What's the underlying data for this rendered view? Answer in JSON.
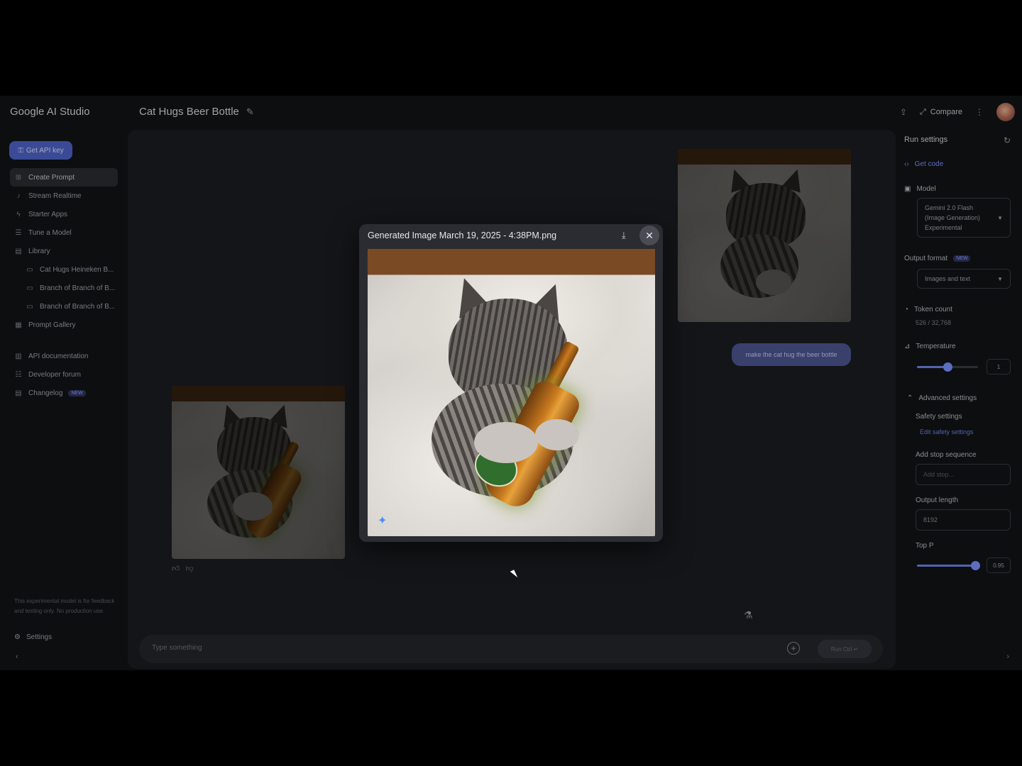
{
  "app": {
    "brand": "Google AI Studio",
    "prompt_title": "Cat Hugs Beer Bottle"
  },
  "topbar": {
    "compare_label": "Compare"
  },
  "sidebar": {
    "api_key_label": "Get API key",
    "items": [
      {
        "label": "Create Prompt",
        "icon": "create-prompt-icon"
      },
      {
        "label": "Stream Realtime",
        "icon": "mic-icon"
      },
      {
        "label": "Starter Apps",
        "icon": "bolt-icon"
      },
      {
        "label": "Tune a Model",
        "icon": "tune-icon"
      },
      {
        "label": "Library",
        "icon": "library-icon"
      },
      {
        "label": "Cat Hugs Heineken B...",
        "icon": "chat-icon"
      },
      {
        "label": "Branch of Branch of B...",
        "icon": "chat-icon"
      },
      {
        "label": "Branch of Branch of B...",
        "icon": "chat-icon"
      },
      {
        "label": "Prompt Gallery",
        "icon": "gallery-icon"
      },
      {
        "label": "API documentation",
        "icon": "docs-icon"
      },
      {
        "label": "Developer forum",
        "icon": "forum-icon"
      },
      {
        "label": "Changelog",
        "icon": "changelog-icon",
        "badge": "NEW"
      }
    ],
    "disclaimer": "This experimental model is for feedback and testing only. No production use.",
    "settings_label": "Settings"
  },
  "chat": {
    "user_message": "make the cat hug the beer bottle",
    "composer_placeholder": "Type something",
    "run_label": "Run  Ctrl ↵"
  },
  "run_settings": {
    "title": "Run settings",
    "get_code": "Get code",
    "model_label": "Model",
    "model_value": "Gemini 2.0 Flash (Image Generation) Experimental",
    "output_format_label": "Output format",
    "output_format_badge": "NEW",
    "output_format_value": "Images and text",
    "token_count_label": "Token count",
    "token_count_value": "526 / 32,768",
    "temperature_label": "Temperature",
    "temperature_value": "1",
    "temperature_fraction": 0.5,
    "advanced_label": "Advanced settings",
    "safety_label": "Safety settings",
    "safety_link": "Edit safety settings",
    "stop_seq_label": "Add stop sequence",
    "stop_seq_placeholder": "Add stop...",
    "output_length_label": "Output length",
    "output_length_value": "8192",
    "top_p_label": "Top P",
    "top_p_value": "0.95",
    "top_p_fraction": 0.95
  },
  "modal": {
    "title": "Generated Image March 19, 2025 - 4:38PM.png"
  },
  "colors": {
    "accent": "#7b93ff",
    "api_button": "#4f63c9",
    "user_bubble": "#4e5690"
  }
}
